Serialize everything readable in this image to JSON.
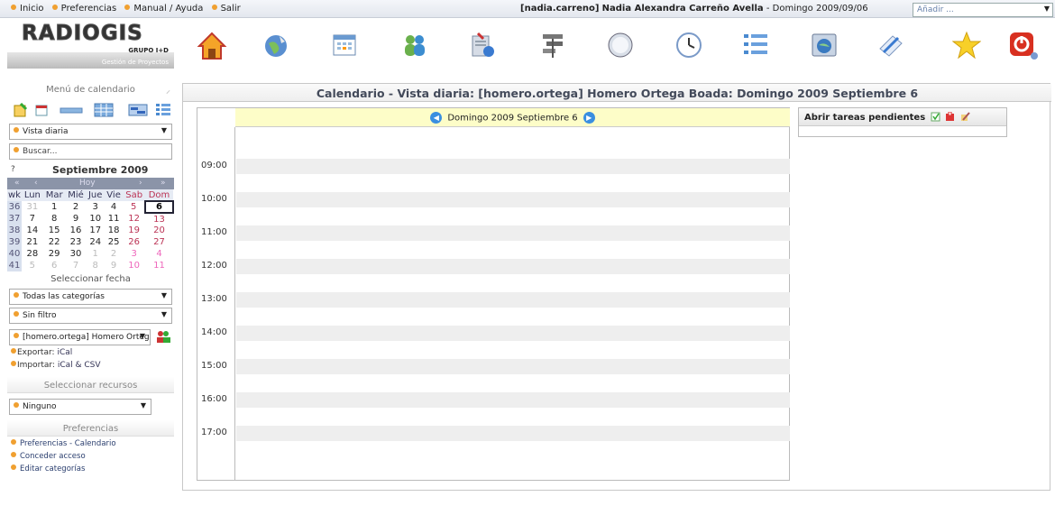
{
  "topnav": {
    "items": [
      "Inicio",
      "Preferencias",
      "Manual / Ayuda",
      "Salir"
    ],
    "user_login": "[nadia.carreno]",
    "user_name": "Nadia Alexandra Carreño Avella",
    "date_text": "- Domingo 2009/09/06",
    "add_select": "Añadir ..."
  },
  "logo": {
    "title": "RADIOGIS",
    "subtitle": "GRUPO I+D",
    "tagline": "Gestión de Proyectos"
  },
  "app_icons": [
    "home-icon",
    "globe-icon",
    "calendar-icon",
    "addressbook-icon",
    "infolog-icon",
    "projects-icon",
    "compass-icon",
    "timesheet-icon",
    "list-icon",
    "browser-icon",
    "notes-icon",
    "star-icon",
    "logout-icon"
  ],
  "sidebar": {
    "menu_title": "Menú de calendario",
    "view_select": "Vista diaria",
    "search_placeholder": "Buscar...",
    "calendar": {
      "help": "?",
      "month": "Septiembre 2009",
      "nav": [
        "«",
        "‹",
        "Hoy",
        "›",
        "»"
      ],
      "headers": [
        "wk",
        "Lun",
        "Mar",
        "Mié",
        "Jue",
        "Vie",
        "Sab",
        "Dom"
      ],
      "weeks": [
        [
          "36",
          "31",
          "1",
          "2",
          "3",
          "4",
          "5",
          "6"
        ],
        [
          "37",
          "7",
          "8",
          "9",
          "10",
          "11",
          "12",
          "13"
        ],
        [
          "38",
          "14",
          "15",
          "16",
          "17",
          "18",
          "19",
          "20"
        ],
        [
          "39",
          "21",
          "22",
          "23",
          "24",
          "25",
          "26",
          "27"
        ],
        [
          "40",
          "28",
          "29",
          "30",
          "1",
          "2",
          "3",
          "4"
        ],
        [
          "41",
          "5",
          "6",
          "7",
          "8",
          "9",
          "10",
          "11"
        ]
      ]
    },
    "select_date": "Seleccionar fecha",
    "category_select": "Todas las categorías",
    "filter_select": "Sin filtro",
    "owner_select": "[homero.ortega] Homero Orteg",
    "export_label": "Exportar:",
    "export_value": "iCal",
    "import_label": "Importar:",
    "import_value": "iCal & CSV",
    "resources_title": "Seleccionar recursos",
    "resources_select": "Ninguno",
    "prefs_title": "Preferencias",
    "pref_links": [
      "Preferencias - Calendario",
      "Conceder acceso",
      "Editar categorías"
    ]
  },
  "main": {
    "title": "Calendario - Vista diaria: [homero.ortega] Homero Ortega Boada: Domingo 2009 Septiembre 6",
    "day_label": "Domingo 2009 Septiembre 6",
    "times": [
      "09:00",
      "10:00",
      "11:00",
      "12:00",
      "13:00",
      "14:00",
      "15:00",
      "16:00",
      "17:00"
    ],
    "pending_title": "Abrir tareas pendientes"
  },
  "colors": {
    "accent": "#f0a030",
    "title": "#434a5a",
    "dayhead_bg": "#fdfdc8",
    "slot": "#eeeeee",
    "nav_button": "#3a8fe0"
  }
}
